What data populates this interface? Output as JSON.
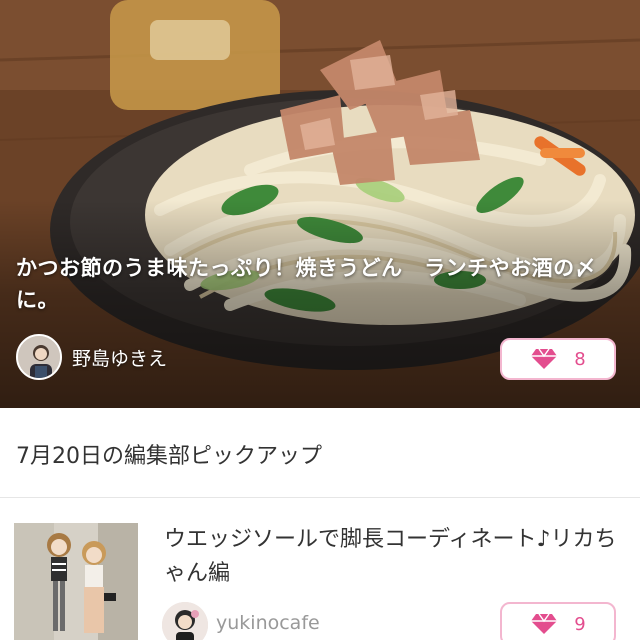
{
  "hero": {
    "title": "かつお節のうま味たっぷり！焼きうどん　ランチやお酒の〆に。",
    "author_name": "野島ゆきえ",
    "like_count": "8"
  },
  "section": {
    "heading": "7月20日の編集部ピックアップ"
  },
  "article": {
    "title": "ウエッジソールで脚長コーディネート♪リカちゃん編",
    "author_name": "yukinocafe",
    "like_count": "9"
  },
  "colors": {
    "accent_pink": "#e34d8e",
    "pill_border": "#f3b6cf"
  },
  "icons": [
    "gem-icon",
    "avatar"
  ]
}
